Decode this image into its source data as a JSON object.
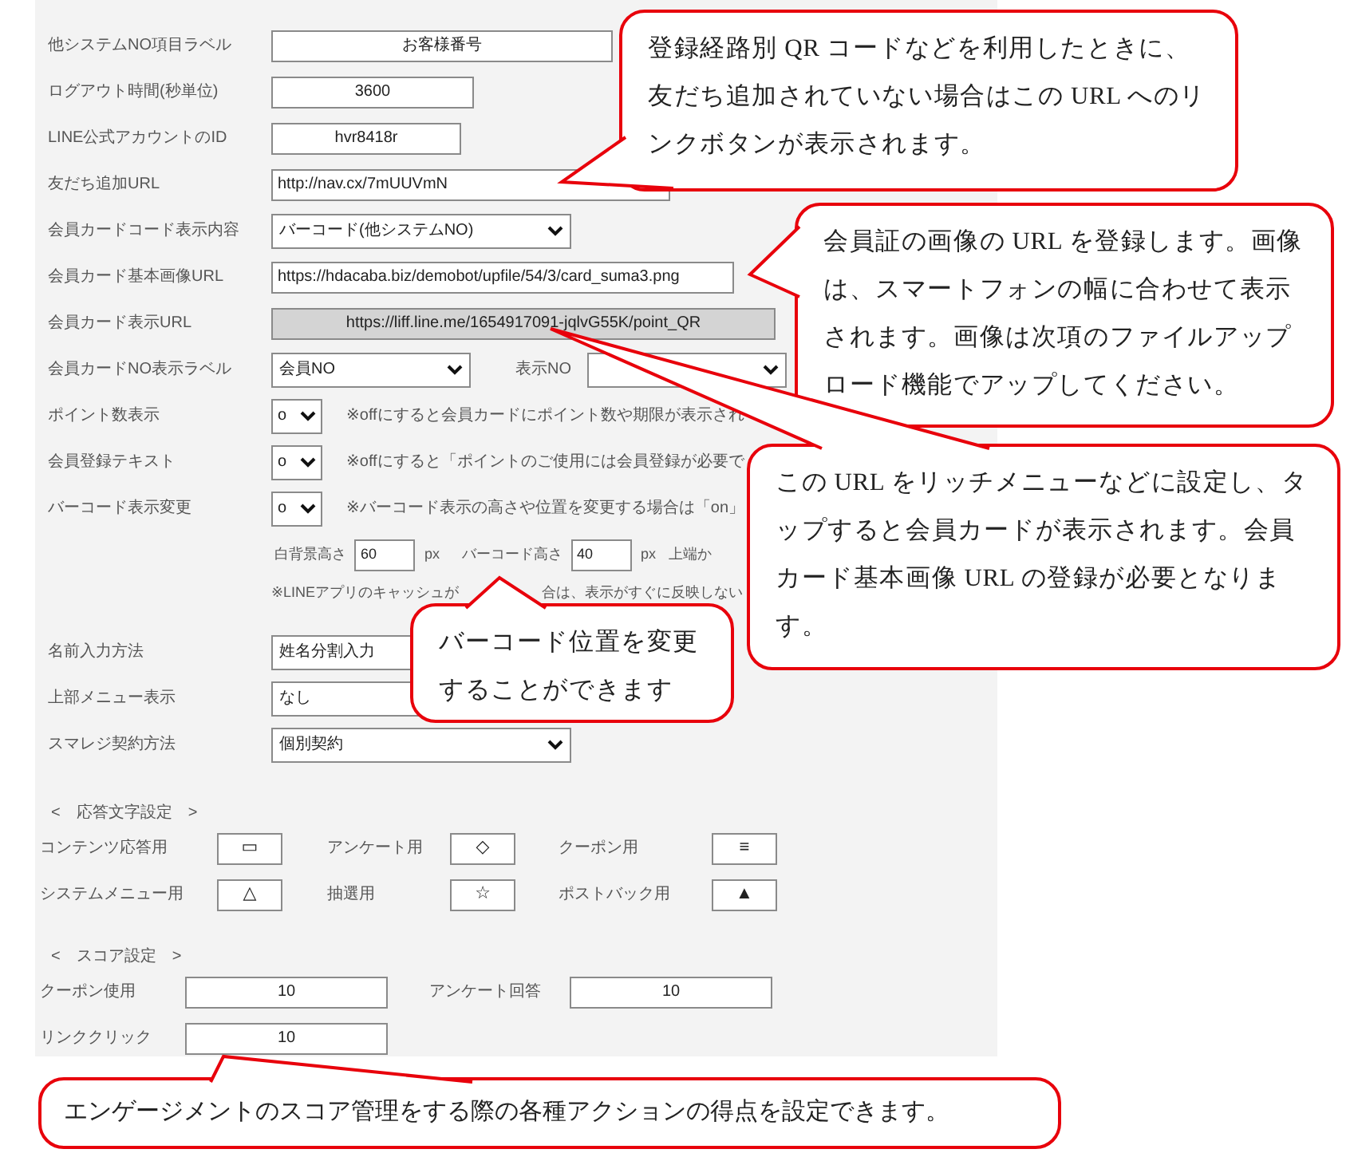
{
  "settings": [
    {
      "kind": "input-center",
      "label": "他システムNO項目ラベル",
      "value": "お客様番号"
    },
    {
      "kind": "input-center",
      "label": "ログアウト時間(秒単位)",
      "value": "3600"
    },
    {
      "kind": "input-center",
      "label": "LINE公式アカウントのID",
      "value": "hvr8418r"
    },
    {
      "kind": "input",
      "label": "友だち追加URL",
      "value": "http://nav.cx/7mUUVmN"
    },
    {
      "kind": "select",
      "label": "会員カードコード表示内容",
      "value": "バーコード(他システムNO)"
    },
    {
      "kind": "input",
      "label": "会員カード基本画像URL",
      "value": "https://hdacaba.biz/demobot/upfile/54/3/card_suma3.png"
    },
    {
      "kind": "readonly",
      "label": "会員カード表示URL",
      "value": "https://liff.line.me/1654917091-jqlvG55K/point_QR"
    },
    {
      "kind": "select-pair",
      "label": "会員カードNO表示ラベル",
      "value": "会員NO",
      "second_label": "表示NO"
    },
    {
      "kind": "toggle",
      "label": "ポイント数表示",
      "value": "o",
      "note": "※offにすると会員カードにポイント数や期限が表示され"
    },
    {
      "kind": "toggle",
      "label": "会員登録テキスト",
      "value": "o",
      "note": "※offにすると「ポイントのご使用には会員登録が必要で"
    },
    {
      "kind": "toggle",
      "label": "バーコード表示変更",
      "value": "o",
      "note": "※バーコード表示の高さや位置を変更する場合は「on」"
    }
  ],
  "barcode_sizes": [
    {
      "label": "白背景高さ",
      "value": "60",
      "unit": "px"
    },
    {
      "label": "バーコード高さ",
      "value": "40",
      "unit": "px"
    },
    {
      "label": "上端か"
    }
  ],
  "cache_note": [
    "※LINEアプリのキャッシュが",
    "合は、表示がすぐに反映しない"
  ],
  "display_settings": [
    {
      "label": "名前入力方法",
      "value": "姓名分割入力"
    },
    {
      "label": "上部メニュー表示",
      "value": "なし"
    },
    {
      "label": "スマレジ契約方法",
      "value": "個別契約"
    }
  ],
  "response_chars": {
    "title": "<　応答文字設定　>",
    "items": [
      {
        "label": "コンテンツ応答用",
        "value": "▭"
      },
      {
        "label": "アンケート用",
        "value": "◇"
      },
      {
        "label": "クーポン用",
        "value": "≡"
      },
      {
        "label": "システムメニュー用",
        "value": "△"
      },
      {
        "label": "抽選用",
        "value": "☆"
      },
      {
        "label": "ポストバック用",
        "value": "▲"
      }
    ]
  },
  "score": {
    "title": "<　スコア設定　>",
    "items": [
      {
        "label": "クーポン使用",
        "value": "10"
      },
      {
        "label": "アンケート回答",
        "value": "10"
      },
      {
        "label": "リンククリック",
        "value": "10"
      }
    ]
  },
  "callouts": [
    {
      "text": "登録経路別 QR コードなどを利用したときに、友だち追加されていない場合はこの URL へのリンクボタンが表示されます。"
    },
    {
      "text": "会員証の画像の URL を登録します。画像は、スマートフォンの幅に合わせて表示されます。画像は次項のファイルアップロード機能でアップしてください。"
    },
    {
      "text": "この URL をリッチメニューなどに設定し、タップすると会員カードが表示されます。会員カード基本画像 URL の登録が必要となります。"
    },
    {
      "text": "バーコード位置を変更することができます"
    },
    {
      "text": "エンゲージメントのスコア管理をする際の各種アクションの得点を設定できます。"
    }
  ]
}
